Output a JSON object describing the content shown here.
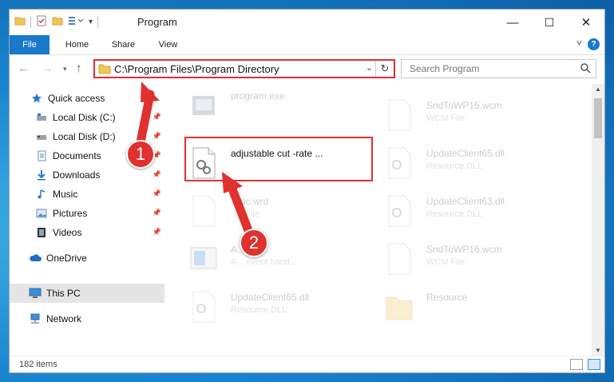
{
  "window": {
    "title": "Program",
    "controls": {
      "minimize": "—",
      "maximize": "☐",
      "close": "✕"
    }
  },
  "ribbon": {
    "tabs": [
      "File",
      "Home",
      "Share",
      "View"
    ],
    "help": "?",
    "expand": "˅"
  },
  "address": {
    "path": "C:\\Program Files\\Program Directory",
    "search_placeholder": "Search Program"
  },
  "sidebar": {
    "items": [
      {
        "label": "Quick access",
        "icon": "star-icon"
      },
      {
        "label": "Local Disk (C:)",
        "icon": "drive-icon",
        "pinned": true
      },
      {
        "label": "Local Disk (D:)",
        "icon": "drive-icon",
        "pinned": true
      },
      {
        "label": "Documents",
        "icon": "documents-icon",
        "pinned": true
      },
      {
        "label": "Downloads",
        "icon": "download-icon",
        "pinned": true
      },
      {
        "label": "Music",
        "icon": "music-icon",
        "pinned": true
      },
      {
        "label": "Pictures",
        "icon": "pictures-icon",
        "pinned": true
      },
      {
        "label": "Videos",
        "icon": "videos-icon",
        "pinned": true
      },
      {
        "label": "OneDrive",
        "icon": "cloud-icon"
      },
      {
        "label": "This PC",
        "icon": "computer-icon",
        "selected": true
      },
      {
        "label": "Network",
        "icon": "network-icon"
      }
    ]
  },
  "files": {
    "left": [
      {
        "name": "program.exe",
        "type": ""
      },
      {
        "name": "adjustable cut -rate ...",
        "type": ""
      },
      {
        "name": "...sic.wrd",
        "type": "...d File"
      },
      {
        "name": "A...ll.exe",
        "type": "A... event hand..."
      },
      {
        "name": "UpdateClient65.dll",
        "type": "Resource DLL"
      }
    ],
    "right": [
      {
        "name": "SndToWP15.wcm",
        "type": "WCM File"
      },
      {
        "name": "UpdateClient65.dll",
        "type": "Resource DLL"
      },
      {
        "name": "UpdateClient63.dll",
        "type": "Resource DLL"
      },
      {
        "name": "SndToWP16.wcm",
        "type": "WCM File"
      },
      {
        "name": "Resource",
        "type": ""
      }
    ]
  },
  "status": {
    "count": "182 items"
  },
  "annotations": {
    "step1": "1",
    "step2": "2"
  },
  "colors": {
    "accent": "#1979ca",
    "highlight": "#e0312e"
  }
}
